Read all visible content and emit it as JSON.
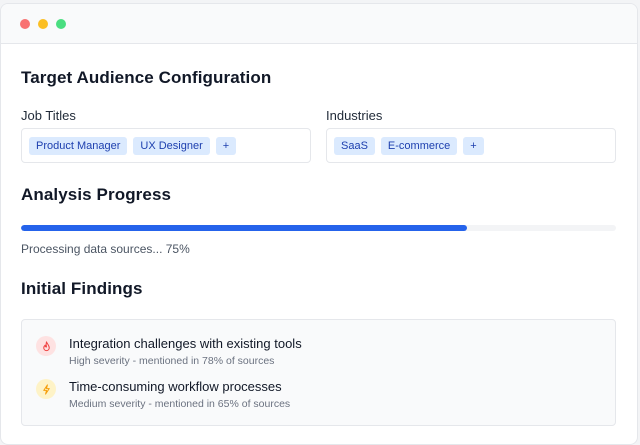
{
  "window": {
    "controls": [
      {
        "name": "close",
        "color": "#f87171"
      },
      {
        "name": "minimize",
        "color": "#fbbf24"
      },
      {
        "name": "maximize",
        "color": "#4ade80"
      }
    ]
  },
  "config": {
    "title": "Target Audience Configuration",
    "job_titles": {
      "label": "Job Titles",
      "tags": [
        "Product Manager",
        "UX Designer"
      ],
      "add_label": "+"
    },
    "industries": {
      "label": "Industries",
      "tags": [
        "SaaS",
        "E-commerce"
      ],
      "add_label": "+"
    }
  },
  "progress": {
    "title": "Analysis Progress",
    "percent": 75,
    "status_text": "Processing data sources... 75%",
    "bar_color": "#2563eb"
  },
  "findings": {
    "title": "Initial Findings",
    "items": [
      {
        "icon": "flame-icon",
        "icon_bg": "#fee2e2",
        "icon_color": "#ef4444",
        "title": "Integration challenges with existing tools",
        "detail": "High severity - mentioned in 78% of sources"
      },
      {
        "icon": "lightning-icon",
        "icon_bg": "#fef3c7",
        "icon_color": "#f59e0b",
        "title": "Time-consuming workflow processes",
        "detail": "Medium severity - mentioned in 65% of sources"
      }
    ]
  }
}
